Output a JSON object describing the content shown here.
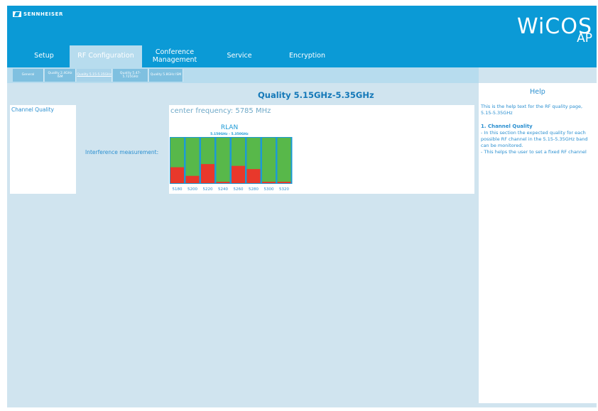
{
  "brand": {
    "name": "SENNHEISER"
  },
  "product": {
    "line1": "WiCOS",
    "line2": "AP"
  },
  "nav": {
    "tabs": [
      {
        "label": "Setup",
        "active": false
      },
      {
        "label": "RF Configuration",
        "active": true
      },
      {
        "label": "Conference Management",
        "active": false
      },
      {
        "label": "Service",
        "active": false
      },
      {
        "label": "Encryption",
        "active": false
      }
    ]
  },
  "subnav": {
    "tabs": [
      {
        "label": "General",
        "active": false
      },
      {
        "label": "Quality 2.4GHz ISM",
        "active": false
      },
      {
        "label": "Quality 5.15-5.35GHz",
        "active": true
      },
      {
        "label": "Quality 5.47-5.725GHz",
        "active": false
      },
      {
        "label": "Quality 5.8GHz ISM",
        "active": false
      }
    ]
  },
  "page": {
    "title": "Quality 5.15GHz-5.35GHz",
    "section_label": "Channel Quality",
    "interference_label": "Interference measurement:",
    "center_frequency": "center frequency: 5785 MHz"
  },
  "chart_data": {
    "type": "bar",
    "title": "RLAN",
    "subtitle": "5.150GHz - 5.350GHz",
    "categories": [
      "5180",
      "5200",
      "5220",
      "5240",
      "5260",
      "5280",
      "5300",
      "5320"
    ],
    "series": [
      {
        "values": [
          0.35,
          0.16,
          0.42,
          0.03,
          0.38,
          0.31,
          0.03,
          0.03
        ]
      }
    ],
    "ylim": [
      0,
      1
    ],
    "colors": {
      "interference": "#e8382b",
      "free": "#58b84a",
      "frame": "#1c9ad6"
    }
  },
  "help": {
    "title": "Help",
    "intro": "This is the help text for the RF quality page, 5.15-5.35GHz",
    "heading": "1. Channel Quality",
    "body": "- In this section the expected quality for each possible RF channel in the 5.15-5.35GHz band can be monitored.\n- This helps the user to set a fixed RF channel"
  }
}
